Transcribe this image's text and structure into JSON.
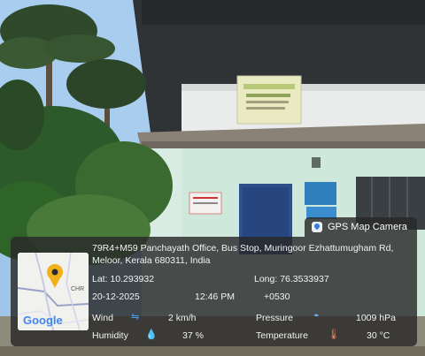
{
  "stamp": {
    "badge_label": "GPS Map Camera",
    "address_line1": "79R4+M59 Panchayath Office, Bus Stop, Muringoor Ezhattumugham Rd,",
    "address_line2": "Meloor, Kerala 680311, India",
    "lat": "Lat: 10.293932",
    "long": "Long: 76.3533937",
    "date": "20-12-2025",
    "time": "12:46 PM",
    "timezone": "+0530",
    "wind_label": "Wind",
    "wind_value": "2 km/h",
    "pressure_label": "Pressure",
    "pressure_value": "1009 hPa",
    "humidity_label": "Humidity",
    "humidity_value": "37 %",
    "temperature_label": "Temperature",
    "temperature_value": "30 °C"
  },
  "map": {
    "logo": "Google",
    "place_fragment": "CHR"
  },
  "icons": {
    "badge": "map-pin-icon",
    "wind": "wind-icon",
    "pressure": "pressure-icon",
    "humidity": "humidity-icon",
    "temperature": "thermometer-icon"
  },
  "colors": {
    "overlay_bg": "#282828",
    "pin": "#f2b11b"
  }
}
